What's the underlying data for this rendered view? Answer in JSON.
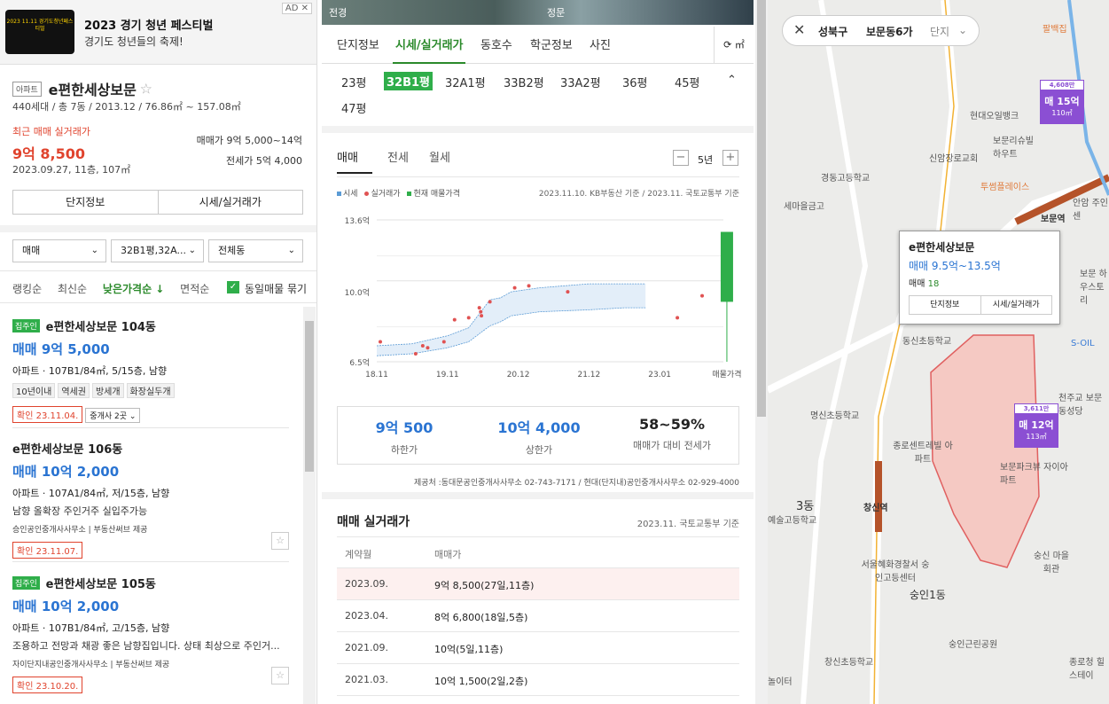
{
  "ad": {
    "title": "2023 경기 청년 페스티벌",
    "subtitle": "경기도 청년들의 축제!",
    "tag": "AD",
    "close": "✕",
    "thumb_text": "2023 11.11 경기도청년페스티벌"
  },
  "complex": {
    "type_tag": "아파트",
    "name": "e편한세상보문",
    "star": "☆",
    "summary": "440세대 / 총 7동 / 2013.12 / 76.86㎡ ~ 157.08㎡",
    "recent_label": "최근 매매 실거래가",
    "recent_price": "9억 8,500",
    "recent_date": "2023.09.27, 11층, 107㎡",
    "sale_range_label": "매매가",
    "sale_range": "9억 5,000~14억",
    "jeonse_range_label": "전세가",
    "jeonse_range": "5억 4,000",
    "btn_info": "단지정보",
    "btn_price": "시세/실거래가"
  },
  "filters": {
    "deal": "매매",
    "size": "32B1평,32A...",
    "dong": "전체동"
  },
  "sort": {
    "items": [
      "랭킹순",
      "최신순",
      "낮은가격순 ↓",
      "면적순"
    ],
    "group_label": "동일매물 묶기",
    "check": "✓"
  },
  "listings": [
    {
      "badge": "집주인",
      "name": "e편한세상보문 104동",
      "price": "매매 9억 5,000",
      "info": "아파트 · 107B1/84㎡, 5/15층, 남향",
      "tags": [
        "10년이내",
        "역세권",
        "방세개",
        "화장실두개"
      ],
      "confirm": "확인 23.11.04.",
      "agent_btn": "중개사 2곳 ⌄"
    },
    {
      "name": "e편한세상보문 106동",
      "price": "매매 10억 2,000",
      "info": "아파트 · 107A1/84㎡, 저/15층, 남향",
      "desc": "남향 올확장 주인거주 실입주가능",
      "agent": "승인공인중개사사무소 | 부동산써브 제공",
      "confirm": "확인 23.11.07."
    },
    {
      "badge": "집주인",
      "name": "e편한세상보문 105동",
      "price": "매매 10억 2,000",
      "info": "아파트 · 107B1/84㎡, 고/15층, 남향",
      "desc": "조용하고 전망과 채광 좋은 남향집입니다. 상태 최상으로 주인거...",
      "agent": "자이단지내공인중개사사무소 | 부동산써브 제공",
      "confirm": "확인 23.10.20."
    }
  ],
  "mid": {
    "photo_left": "전경",
    "photo_right": "정문",
    "tabs": [
      "단지정보",
      "시세/실거래가",
      "동호수",
      "학군정보",
      "사진"
    ],
    "refresh": "⟳ ㎡",
    "pyeong": [
      "23평",
      "32B1평",
      "32A1평",
      "33B2평",
      "33A2평",
      "36평",
      "45평",
      "47평"
    ],
    "collapse": "⌃",
    "chart_tabs": [
      "매매",
      "전세",
      "월세"
    ],
    "minus": "−",
    "plus": "+",
    "years": "5년",
    "legend": [
      "시세",
      "실거래가",
      "현재 매물가격"
    ],
    "basis": "2023.11.10. KB부동산 기준 / 2023.11. 국토교통부 기준",
    "summary": [
      {
        "value": "9억 500",
        "label": "하한가",
        "color": "#2a74d2"
      },
      {
        "value": "10억 4,000",
        "label": "상한가",
        "color": "#2a74d2"
      },
      {
        "value": "58~59%",
        "label": "매매가 대비 전세가",
        "color": "#222"
      }
    ],
    "provider": "제공처 :동대문공인중개사사무소 02-743-7171 / 현대(단지내)공인중개사사무소 02-929-4000",
    "rt_title": "매매 실거래가",
    "rt_basis": "2023.11. 국토교통부 기준",
    "rt_head": [
      "계약월",
      "매매가"
    ],
    "rt_rows": [
      [
        "2023.09.",
        "9억 8,500(27일,11층)"
      ],
      [
        "2023.04.",
        "8억 6,800(18일,5층)"
      ],
      [
        "2021.09.",
        "10억(5일,11층)"
      ],
      [
        "2021.03.",
        "10억 1,500(2일,2층)"
      ]
    ]
  },
  "chart_data": {
    "type": "line",
    "x_tick_labels": [
      "18.11",
      "19.11",
      "20.12",
      "21.12",
      "23.01",
      "매물가격"
    ],
    "y_tick_labels": [
      "13.6억",
      "10.0억",
      "6.5억"
    ],
    "ylim": [
      6.5,
      13.6
    ],
    "series": [
      {
        "name": "시세",
        "type": "band",
        "color": "#5b9bd5",
        "x": [
          0,
          0.5,
          1.0,
          1.3,
          1.6,
          1.75,
          1.9,
          2.3,
          3.0,
          3.5,
          3.8
        ],
        "lower": [
          6.8,
          6.9,
          7.2,
          7.5,
          8.3,
          8.5,
          8.8,
          9.0,
          9.1,
          9.2,
          9.2
        ],
        "upper": [
          7.3,
          7.4,
          7.8,
          8.2,
          9.6,
          9.7,
          10.0,
          10.2,
          10.4,
          10.4,
          10.4
        ]
      },
      {
        "name": "실거래가",
        "type": "scatter",
        "color": "#e05252",
        "points": [
          [
            0.05,
            7.5
          ],
          [
            0.55,
            6.9
          ],
          [
            0.65,
            7.3
          ],
          [
            0.72,
            7.2
          ],
          [
            0.95,
            7.5
          ],
          [
            1.1,
            8.6
          ],
          [
            1.3,
            8.7
          ],
          [
            1.45,
            9.2
          ],
          [
            1.47,
            9.0
          ],
          [
            1.48,
            8.8
          ],
          [
            1.6,
            9.5
          ],
          [
            1.95,
            10.2
          ],
          [
            2.15,
            10.3
          ],
          [
            2.7,
            10.0
          ],
          [
            4.25,
            8.7
          ],
          [
            4.6,
            9.8
          ]
        ]
      },
      {
        "name": "현재 매물가격",
        "type": "bar",
        "color": "#2fae4a",
        "min": 9.5,
        "max": 13.0
      }
    ]
  },
  "map": {
    "close": "✕",
    "region": "성북구",
    "dong": "보문동6가",
    "filter": "단지",
    "labels": [
      "팔백집",
      "현대오일뱅크",
      "보문리슈빌 하우트",
      "신암장로교회",
      "경동고등학교",
      "세마을금고",
      "투썸플레이스",
      "보문역",
      "안암 주인센",
      "동신초등학교",
      "명신초등학교",
      "종로센트레빌 아파트",
      "보문파크뷰 자이아파트",
      "3동",
      "창신역",
      "서울혜화경찰서 숭인고등센터",
      "숭인1동",
      "숭인근린공원",
      "창신초등학교",
      "숭신 마을회관",
      "종로청 힐스테이",
      "S-OIL",
      "보문 하우스토리",
      "천주교 보문동성당",
      "예술고등학교",
      "놀이터"
    ],
    "flags": [
      {
        "top": "4,608만",
        "main": "매 15억",
        "size": "110㎡"
      },
      {
        "top": "3,611만",
        "main": "매 12억",
        "size": "113㎡"
      }
    ],
    "popup": {
      "name": "e편한세상보문",
      "price": "매매 9.5억~13.5억",
      "count_label": "매매",
      "count": "18",
      "btn_info": "단지정보",
      "btn_price": "시세/실거래가"
    }
  }
}
